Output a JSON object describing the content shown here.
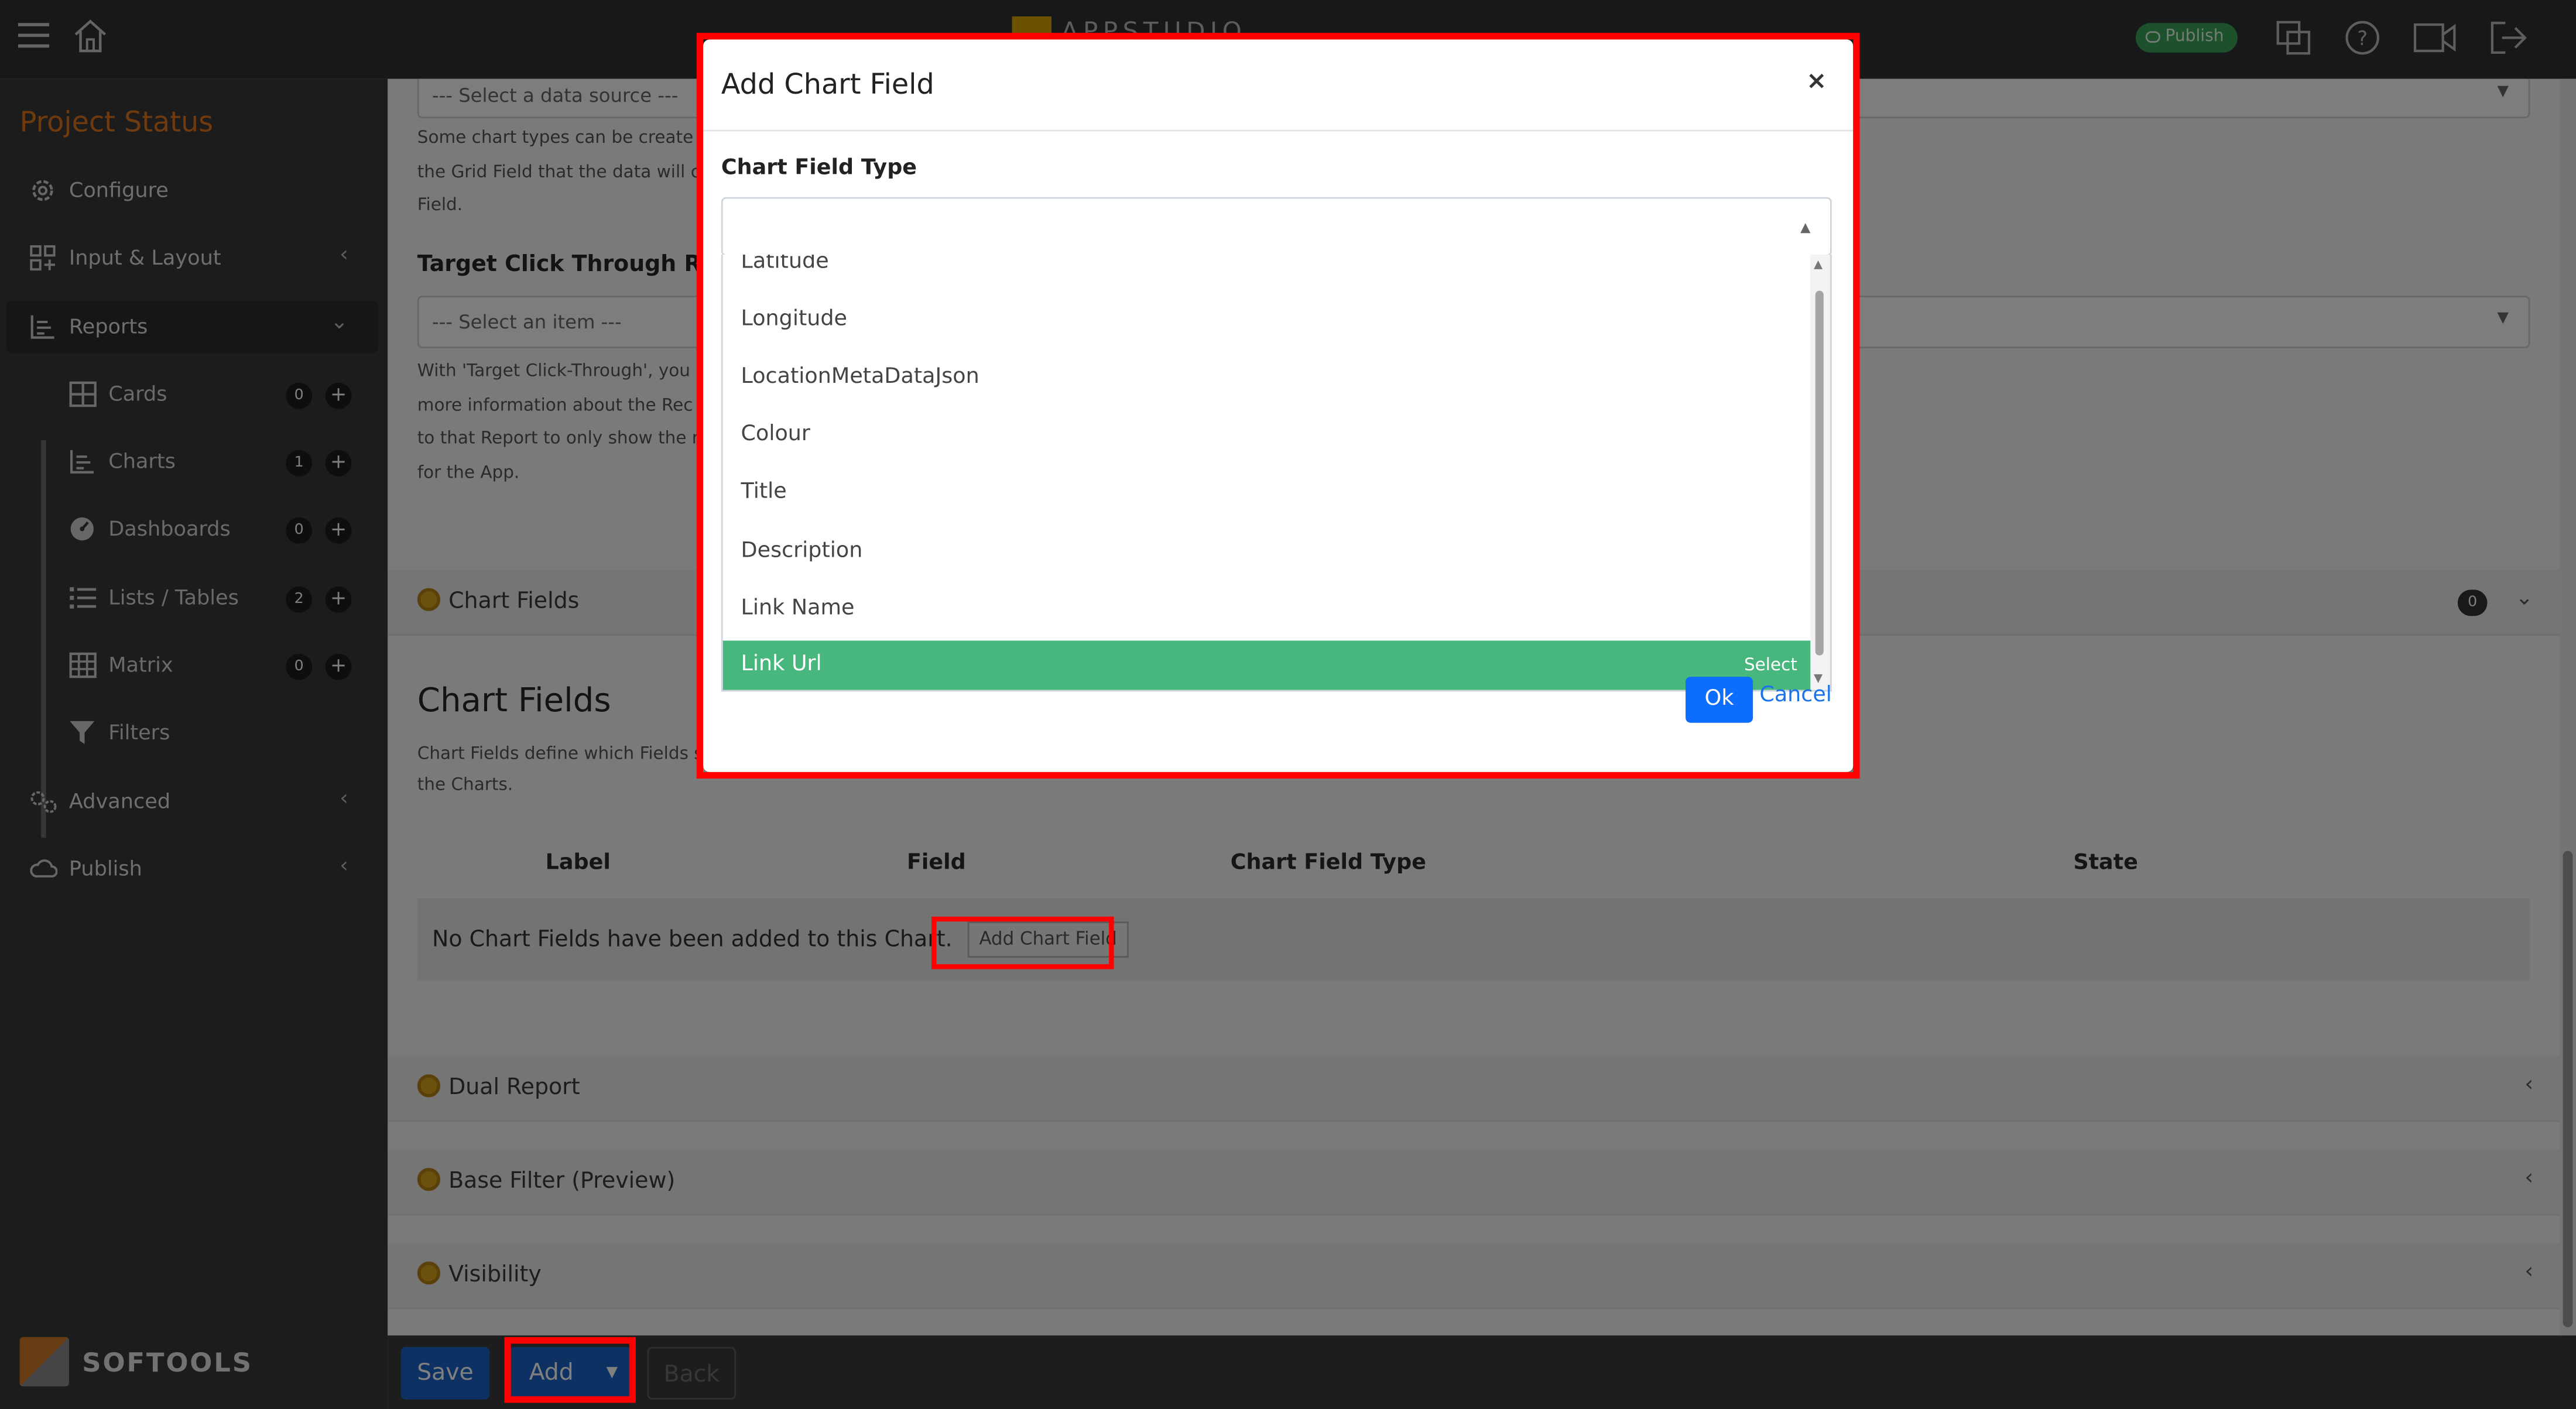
{
  "topbar": {
    "brand_text": "APPSTUDIO",
    "publish_label": "Publish"
  },
  "sidebar": {
    "project_title": "Project Status",
    "items": [
      {
        "label": "Configure"
      },
      {
        "label": "Input & Layout"
      },
      {
        "label": "Reports"
      },
      {
        "label": "Advanced"
      },
      {
        "label": "Publish"
      }
    ],
    "sub_items": [
      {
        "label": "Cards",
        "count": "0",
        "plus": "+"
      },
      {
        "label": "Charts",
        "count": "1",
        "plus": "+"
      },
      {
        "label": "Dashboards",
        "count": "0",
        "plus": "+"
      },
      {
        "label": "Lists / Tables",
        "count": "2",
        "plus": "+"
      },
      {
        "label": "Matrix",
        "count": "0",
        "plus": "+"
      },
      {
        "label": "Filters"
      }
    ],
    "logo_text": "SOFTOOLS"
  },
  "main": {
    "data_source_select": "--- Select a data source ---",
    "help_1": [
      "Some chart types can be create",
      "the Grid Field that the data will c",
      "Field."
    ],
    "target_heading": "Target Click Through Rep",
    "item_select": "--- Select an item ---",
    "help_2": [
      "With 'Target Click-Through', you",
      "more information about the Rec",
      "to that Report to only show the r",
      "for the App."
    ],
    "chart_fields_panel": "Chart Fields",
    "chart_fields_count": "0",
    "chart_fields_title": "Chart Fields",
    "help_3": [
      "Chart Fields define which Fields s",
      "the Charts."
    ],
    "table_headers": [
      "Label",
      "Field",
      "Chart Field Type",
      "State"
    ],
    "empty_message": "No Chart Fields have been added to this Chart.",
    "add_chart_field_label": "Add Chart Field",
    "panels": [
      "Dual Report",
      "Base Filter (Preview)",
      "Visibility"
    ]
  },
  "bottombar": {
    "save_label": "Save",
    "add_label": "Add",
    "back_label": "Back"
  },
  "modal": {
    "title": "Add Chart Field",
    "close_label": "×",
    "field_label": "Chart Field Type",
    "options": [
      "Latitude",
      "Longitude",
      "LocationMetaDataJson",
      "Colour",
      "Title",
      "Description",
      "Link Name",
      "Link Url"
    ],
    "highlighted_option": "Link Url",
    "select_hint": "Select",
    "ok_label": "Ok",
    "cancel_label": "Cancel"
  },
  "colors": {
    "highlight_green": "#48b77d",
    "primary_blue": "#1a63c6",
    "accent_orange": "#e0741f",
    "annotation_red": "#ff0000"
  }
}
